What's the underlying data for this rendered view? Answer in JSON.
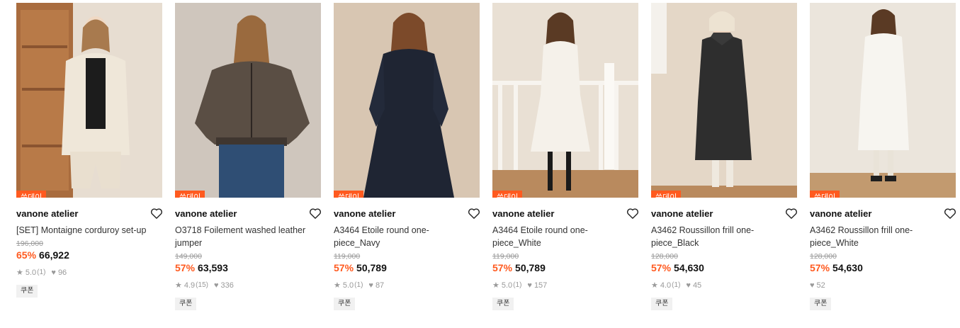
{
  "colors": {
    "accent": "#ff5a1f",
    "muted": "#999999"
  },
  "products": [
    {
      "badge": "쓱데이",
      "brand": "vanone atelier",
      "name": "[SET] Montaigne corduroy set-up",
      "original_price": "196,000",
      "discount": "65%",
      "price": "66,922",
      "rating": "5.0",
      "review_count": "(1)",
      "likes": "96",
      "coupon": "쿠폰",
      "show_rating": true
    },
    {
      "badge": "쓱데이",
      "brand": "vanone atelier",
      "name": "O3718 Foilement washed leather jumper",
      "original_price": "149,000",
      "discount": "57%",
      "price": "63,593",
      "rating": "4.9",
      "review_count": "(15)",
      "likes": "336",
      "coupon": "쿠폰",
      "show_rating": true
    },
    {
      "badge": "쓱데이",
      "brand": "vanone atelier",
      "name": "A3464 Etoile round one-piece_Navy",
      "original_price": "119,000",
      "discount": "57%",
      "price": "50,789",
      "rating": "5.0",
      "review_count": "(1)",
      "likes": "87",
      "coupon": "쿠폰",
      "show_rating": true
    },
    {
      "badge": "쓱데이",
      "brand": "vanone atelier",
      "name": "A3464 Etoile round one-piece_White",
      "original_price": "119,000",
      "discount": "57%",
      "price": "50,789",
      "rating": "5.0",
      "review_count": "(1)",
      "likes": "157",
      "coupon": "쿠폰",
      "show_rating": true
    },
    {
      "badge": "쓱데이",
      "brand": "vanone atelier",
      "name": "A3462 Roussillon frill one-piece_Black",
      "original_price": "128,000",
      "discount": "57%",
      "price": "54,630",
      "rating": "4.0",
      "review_count": "(1)",
      "likes": "45",
      "coupon": "쿠폰",
      "show_rating": true
    },
    {
      "badge": "쓱데이",
      "brand": "vanone atelier",
      "name": "A3462 Roussillon frill one-piece_White",
      "original_price": "128,000",
      "discount": "57%",
      "price": "54,630",
      "rating": "",
      "review_count": "",
      "likes": "52",
      "coupon": "쿠폰",
      "show_rating": false
    }
  ]
}
